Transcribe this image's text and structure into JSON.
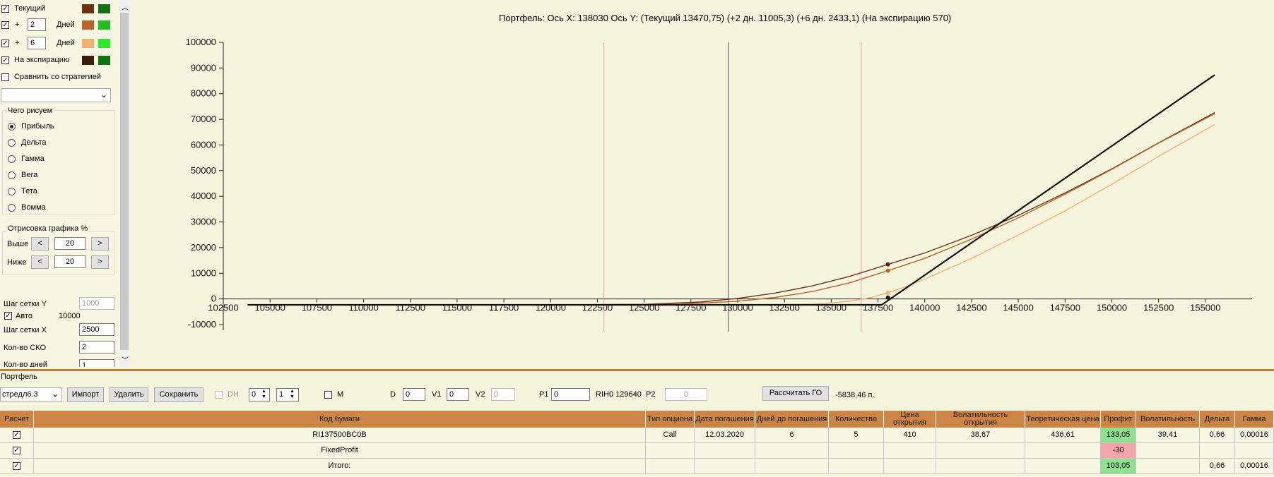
{
  "left_panel": {
    "curves": [
      {
        "label": "Текущий",
        "checked": true,
        "color1": "#6b3415",
        "color2": "#0f7410"
      },
      {
        "prefix": "+",
        "days": "2",
        "suffix": "Дней",
        "checked": true,
        "color1": "#b9622a",
        "color2": "#1ec01e"
      },
      {
        "prefix": "+",
        "days": "6",
        "suffix": "Дней",
        "checked": true,
        "color1": "#f8b070",
        "color2": "#2bea2b"
      },
      {
        "label": "На экспирацию",
        "checked": true,
        "color1": "#3a1e0c",
        "color2": "#0f7410"
      }
    ],
    "compare_label": "Сравнить со стратегией",
    "draw_group_title": "Чего рисуем",
    "draw_options": [
      "Прибыль",
      "Дельта",
      "Гамма",
      "Вега",
      "Тета",
      "Вомма"
    ],
    "draw_selected": "Прибыль",
    "render_group_title": "Отрисовка графика %",
    "above_label": "Выше",
    "above_value": "20",
    "below_label": "Ниже",
    "below_value": "20",
    "btn_less": "<",
    "btn_more": ">",
    "grid_y_label": "Шаг сетки Y",
    "grid_y_value": "1000",
    "auto_label": "Авто",
    "auto_value": "10000",
    "grid_x_label": "Шаг сетки X",
    "grid_x_value": "2500",
    "sko_label": "Кол-во СКО",
    "sko_value": "2",
    "days_label": "Кол-во дней",
    "days_value": "1"
  },
  "chart_data": {
    "type": "line",
    "title": "Портфель: Ось X: 138030 Ось Y:  (Текущий 13470,75)  (+2 дн. 11005,3)  (+6 дн. 2433,1)  (На экспирацию 570)",
    "xlim": [
      102500,
      157500
    ],
    "ylim": [
      -10000,
      100000
    ],
    "x_ticks": [
      102500,
      105000,
      107500,
      110000,
      112500,
      115000,
      117500,
      120000,
      122500,
      125000,
      127500,
      130000,
      132500,
      135000,
      137500,
      140000,
      142500,
      145000,
      147500,
      150000,
      152500,
      155000
    ],
    "y_ticks": [
      -10000,
      0,
      10000,
      20000,
      30000,
      40000,
      50000,
      60000,
      70000,
      80000,
      90000,
      100000
    ],
    "vertical_lines": [
      {
        "x": 122850,
        "color": "#f2a0a0"
      },
      {
        "x": 129500,
        "color": "#555555"
      },
      {
        "x": 136600,
        "color": "#f2a0a0"
      }
    ],
    "series": [
      {
        "name": "Текущий",
        "color": "#6b3415",
        "x": [
          103800,
          120000,
          125000,
          128000,
          130000,
          132000,
          134000,
          136000,
          138030,
          140000,
          142500,
          145000,
          147500,
          150000,
          152500,
          155500
        ],
        "y": [
          -2300,
          -2300,
          -2100,
          -1200,
          200,
          2300,
          5100,
          8800,
          13470,
          17900,
          24800,
          32600,
          41300,
          50700,
          60800,
          72600
        ]
      },
      {
        "name": "+2 дн.",
        "color": "#b9622a",
        "x": [
          103800,
          122000,
          127000,
          130000,
          132000,
          134000,
          136000,
          138030,
          140000,
          142500,
          145000,
          147500,
          150000,
          152500,
          155500
        ],
        "y": [
          -2300,
          -2300,
          -2000,
          -900,
          600,
          2900,
          6300,
          11005,
          15800,
          23300,
          31600,
          40800,
          50500,
          60700,
          72200
        ]
      },
      {
        "name": "+6 дн.",
        "color": "#f8b070",
        "x": [
          103800,
          130000,
          134000,
          136000,
          137000,
          138030,
          139000,
          140000,
          142500,
          145000,
          147500,
          150000,
          152500,
          155500
        ],
        "y": [
          -2300,
          -2300,
          -2100,
          -900,
          300,
          2433,
          4800,
          7700,
          15800,
          24900,
          34300,
          44700,
          55600,
          68000
        ]
      },
      {
        "name": "На экспирацию",
        "color": "#111111",
        "x": [
          103800,
          137700,
          155500
        ],
        "y": [
          -2300,
          -2300,
          87300
        ]
      }
    ],
    "markers": [
      {
        "x": 138030,
        "y": 13470,
        "color": "#4a2310"
      },
      {
        "x": 138030,
        "y": 11005,
        "color": "#b9622a"
      },
      {
        "x": 138030,
        "y": 2433,
        "color": "#f8b070"
      },
      {
        "x": 138030,
        "y": 570,
        "color": "#111111"
      }
    ]
  },
  "portfolio": {
    "section_label": "Портфель",
    "combo_value": "стредл6.3",
    "import_label": "Импорт",
    "delete_label": "Удалить",
    "save_label": "Сохранить",
    "dh_label": "DH",
    "spin1": "0",
    "spin2": "1",
    "m_label": "M",
    "d_label": "D",
    "d_value": "0",
    "v1_label": "V1",
    "v1_value": "0",
    "v2_label": "V2",
    "v2_value": "0",
    "p1_label": "P1",
    "p1_value": "0",
    "rih_label": "RIH0 129640",
    "p2_label": "P2",
    "p2_value": "0",
    "calc_label": "Рассчитать ГО",
    "go_value": "-5838,46 п."
  },
  "table": {
    "headers": [
      "Расчет",
      "Код бумаги",
      "Тип опциона",
      "Дата погашения",
      "Дней до погашения",
      "Количество",
      "Цена открытия",
      "Волатильность открытия",
      "Теоретическая цена",
      "Профит",
      "Волатильность",
      "Дельта",
      "Гамма"
    ],
    "rows": [
      {
        "checked": true,
        "cells": [
          "RI137500BC0B",
          "Call",
          "12.03.2020",
          "6",
          "5",
          "410",
          "38,67",
          "436,61",
          "133,05",
          "39,41",
          "0,66",
          "0,00016"
        ],
        "profit_style": "green"
      },
      {
        "checked": true,
        "cells": [
          "FixedProfit",
          "",
          "",
          "",
          "",
          "",
          "",
          "",
          "-30",
          "",
          "",
          ""
        ],
        "profit_style": "pink"
      },
      {
        "checked": true,
        "cells": [
          "Итого:",
          "",
          "",
          "",
          "",
          "",
          "",
          "",
          "103,05",
          "",
          "0,66",
          "0,00016"
        ],
        "profit_style": "green"
      }
    ]
  }
}
